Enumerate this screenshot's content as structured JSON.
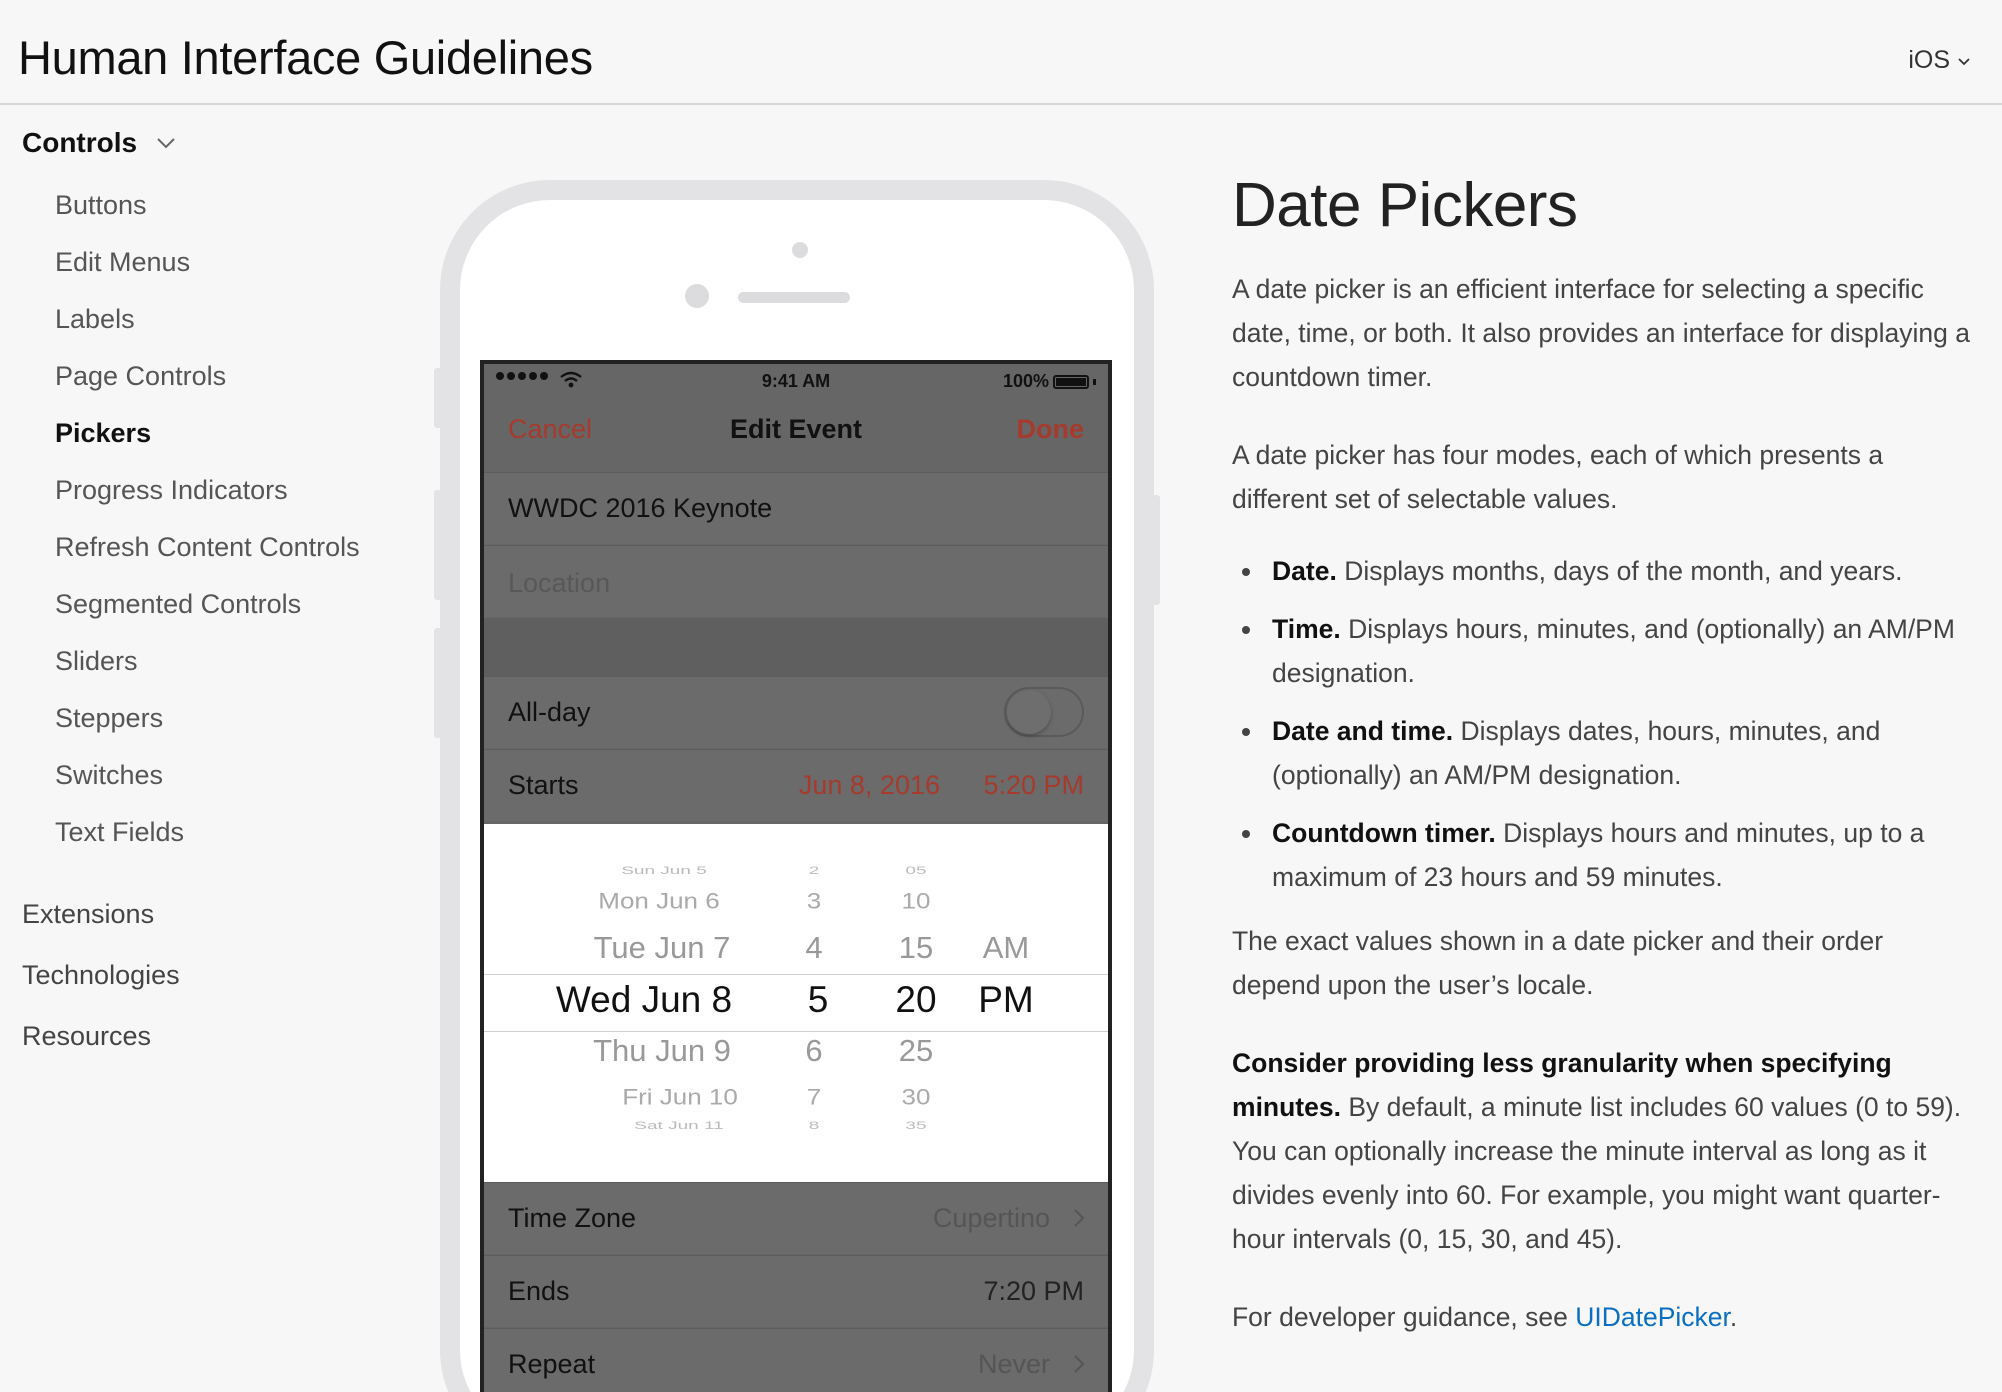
{
  "header": {
    "title": "Human Interface Guidelines",
    "platform_label": "iOS",
    "platform_icon": "chevron-down-icon"
  },
  "sidebar": {
    "section": {
      "label": "Controls",
      "icon": "chevron-down-icon"
    },
    "sub_items": [
      {
        "label": "Buttons",
        "active": false
      },
      {
        "label": "Edit Menus",
        "active": false
      },
      {
        "label": "Labels",
        "active": false
      },
      {
        "label": "Page Controls",
        "active": false
      },
      {
        "label": "Pickers",
        "active": true
      },
      {
        "label": "Progress Indicators",
        "active": false
      },
      {
        "label": "Refresh Content Controls",
        "active": false
      },
      {
        "label": "Segmented Controls",
        "active": false
      },
      {
        "label": "Sliders",
        "active": false
      },
      {
        "label": "Steppers",
        "active": false
      },
      {
        "label": "Switches",
        "active": false
      },
      {
        "label": "Text Fields",
        "active": false
      }
    ],
    "top_items": [
      {
        "label": "Extensions"
      },
      {
        "label": "Technologies"
      },
      {
        "label": "Resources"
      }
    ]
  },
  "phone": {
    "status": {
      "time": "9:41 AM",
      "battery": "100%"
    },
    "nav": {
      "cancel": "Cancel",
      "title": "Edit Event",
      "done": "Done"
    },
    "event_title": "WWDC 2016 Keynote",
    "location_placeholder": "Location",
    "allday_label": "All-day",
    "allday_on": false,
    "starts": {
      "label": "Starts",
      "date": "Jun 8, 2016",
      "time": "5:20 PM"
    },
    "picker": {
      "dates": [
        "Sun Jun 5",
        "Mon Jun 6",
        "Tue Jun 7",
        "Wed Jun 8",
        "Thu Jun 9",
        "Fri Jun 10",
        "Sat Jun 11"
      ],
      "hours": [
        "2",
        "3",
        "4",
        "5",
        "6",
        "7",
        "8"
      ],
      "minutes": [
        "05",
        "10",
        "15",
        "20",
        "25",
        "30",
        "35"
      ],
      "ampm": [
        "AM",
        "PM"
      ]
    },
    "timezone": {
      "label": "Time Zone",
      "value": "Cupertino"
    },
    "ends": {
      "label": "Ends",
      "value": "7:20 PM"
    },
    "repeat": {
      "label": "Repeat",
      "value": "Never"
    },
    "accent_color": "#a53a2d"
  },
  "article": {
    "title": "Date Pickers",
    "intro": "A date picker is an efficient interface for selecting a specific date, time, or both. It also provides an interface for displaying a countdown timer.",
    "modes_intro": "A date picker has four modes, each of which presents a different set of selectable values.",
    "modes": [
      {
        "name": "Date.",
        "desc": "Displays months, days of the month, and years."
      },
      {
        "name": "Time.",
        "desc": "Displays hours, minutes, and (optionally) an AM/PM designation."
      },
      {
        "name": "Date and time.",
        "desc": "Displays dates, hours, minutes, and (optionally) an AM/PM designation."
      },
      {
        "name": "Countdown timer.",
        "desc": "Displays hours and minutes, up to a maximum of 23 hours and 59 minutes."
      }
    ],
    "locale_note": "The exact values shown in a date picker and their order depend upon the user’s locale.",
    "granularity_heading": "Consider providing less granularity when specifying minutes.",
    "granularity_body": "By default, a minute list includes 60 values (0 to 59). You can optionally increase the minute interval as long as it divides evenly into 60. For example, you might want quarter-hour intervals (0, 15, 30, and 45).",
    "dev_prefix": "For developer guidance, see",
    "dev_link": "UIDatePicker",
    "dev_suffix": ".",
    "link_color": "#0a6fc2"
  }
}
